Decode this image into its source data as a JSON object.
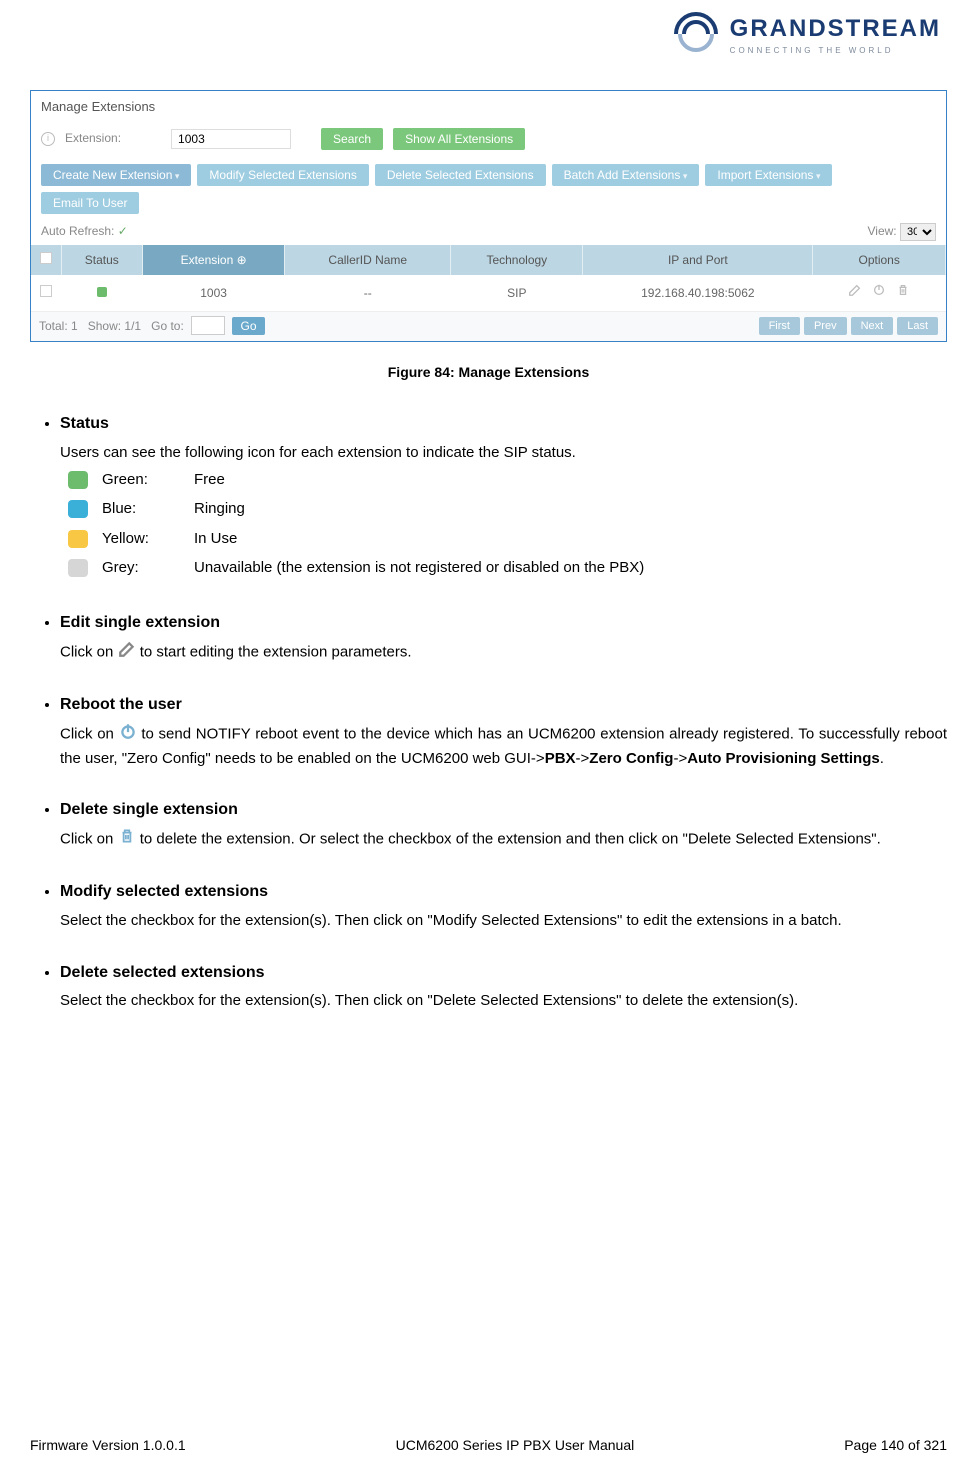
{
  "logo": {
    "main": "GRANDSTREAM",
    "sub": "CONNECTING THE WORLD"
  },
  "shot": {
    "panel_title": "Manage Extensions",
    "ext_label": "Extension:",
    "ext_value": "1003",
    "search_btn": "Search",
    "show_all_btn": "Show All Extensions",
    "toolbar": {
      "create": "Create New Extension",
      "modify": "Modify Selected Extensions",
      "delete": "Delete Selected Extensions",
      "batch": "Batch Add Extensions",
      "import": "Import Extensions",
      "email": "Email To User"
    },
    "auto_refresh": "Auto Refresh:",
    "view_label": "View:",
    "view_value": "30",
    "headers": {
      "status": "Status",
      "extension": "Extension ⊕",
      "callerid": "CallerID Name",
      "tech": "Technology",
      "ipport": "IP and Port",
      "options": "Options"
    },
    "row": {
      "extension": "1003",
      "callerid": "--",
      "tech": "SIP",
      "ipport": "192.168.40.198:5062"
    },
    "foot": {
      "total": "Total: 1",
      "show": "Show: 1/1",
      "goto": "Go to:",
      "go": "Go",
      "first": "First",
      "prev": "Prev",
      "next": "Next",
      "last": "Last"
    }
  },
  "caption": "Figure 84: Manage Extensions",
  "sections": {
    "s1": {
      "title": "Status",
      "intro": "Users can see the following icon for each extension to indicate the SIP status.",
      "rows": {
        "g": {
          "name": "Green:",
          "desc": "Free"
        },
        "b": {
          "name": "Blue:",
          "desc": "Ringing"
        },
        "y": {
          "name": "Yellow:",
          "desc": "In Use"
        },
        "gr": {
          "name": "Grey:",
          "desc": "Unavailable (the extension is not registered or disabled on the PBX)"
        }
      }
    },
    "s2": {
      "title": "Edit single extension",
      "pre": "Click on ",
      "post": "to start editing the extension parameters."
    },
    "s3": {
      "title": "Reboot the user",
      "pre": "Click on ",
      "mid": " to send NOTIFY reboot event to the device which has an UCM6200 extension already registered. To successfully reboot the user, \"Zero Config\" needs to be enabled on the UCM6200 web GUI->",
      "b1": "PBX",
      "arrow1": "->",
      "b2": "Zero Config",
      "arrow2": "->",
      "b3": "Auto Provisioning Settings",
      "end": "."
    },
    "s4": {
      "title": "Delete single extension",
      "pre": "Click on ",
      "post": " to delete the extension. Or select the checkbox of the extension and then click on \"Delete Selected Extensions\"."
    },
    "s5": {
      "title": "Modify selected extensions",
      "body": "Select the checkbox for the extension(s). Then click on \"Modify Selected Extensions\" to edit the extensions in a batch."
    },
    "s6": {
      "title": "Delete selected extensions",
      "body": "Select the checkbox for the extension(s). Then click on \"Delete Selected Extensions\" to delete the extension(s)."
    }
  },
  "footer": {
    "left": "Firmware Version 1.0.0.1",
    "center": "UCM6200 Series IP PBX User Manual",
    "right": "Page 140 of 321"
  }
}
